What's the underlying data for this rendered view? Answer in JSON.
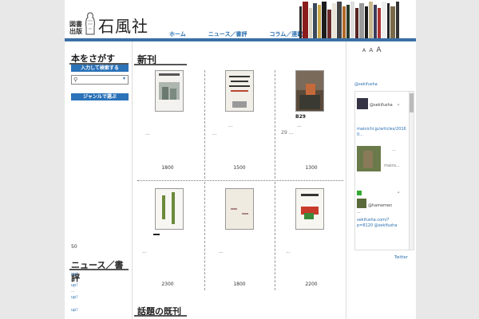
{
  "brand": {
    "seal": "図書出版",
    "name": "石風社"
  },
  "nav": [
    "ホーム",
    "ニュース／書評",
    "コラム／連載"
  ],
  "header_book_colors": [
    "#2a2a2a",
    "#8a1c1c",
    "#d8d2c0",
    "#3a4a5a",
    "#c9a84a",
    "#1c1c1c",
    "#6a2a2a",
    "#e8e4d8",
    "#444",
    "#b06a2a",
    "#2a3a2a",
    "#ddd",
    "#552222",
    "#999",
    "#1a1a1a",
    "#c8b890",
    "#3b3b5b",
    "#aa3333",
    "#eee",
    "#222",
    "#7a6a4a",
    "#333"
  ],
  "sidebar": {
    "search_heading": "本をさがす",
    "input_search_label": "入力して検索する",
    "search_placeholder": "",
    "genre_label": "ジャンルで選ぶ",
    "count": "50",
    "news_heading": "ニュース／書評",
    "news_items": [
      "up!",
      "up!",
      "...",
      "up!",
      "up!"
    ]
  },
  "main": {
    "new_heading": "新刊",
    "books": [
      {
        "dots": "...",
        "extra": "",
        "price": "1800"
      },
      {
        "dots": "...",
        "extra": "",
        "price": "1500"
      },
      {
        "dots": "...",
        "extra": "29 ...",
        "title_label": "B29",
        "price": "1300"
      },
      {
        "dots": "...",
        "extra": "",
        "price": "2300"
      },
      {
        "dots": "...",
        "extra": "",
        "price": "1800"
      },
      {
        "dots": "...",
        "extra": "",
        "price": "2200"
      }
    ],
    "topic_heading": "話題の既刊"
  },
  "right": {
    "font_size": [
      "A",
      "A",
      "A"
    ],
    "twitter_handle": "@sekifusha",
    "feed": {
      "account": "@sekifusha",
      "link1": "mainichi.jp/articles/2016 0...",
      "card_more": "...",
      "card_label": "mains...",
      "hamemen": "@hamemen",
      "dots": "...",
      "link2": "sekifusha.com/?p=8120 @sekifusha"
    },
    "twitter_label": "Twitter"
  },
  "colors": {
    "accent": "#2b72b8",
    "header_bar": "#3b6fa5"
  }
}
